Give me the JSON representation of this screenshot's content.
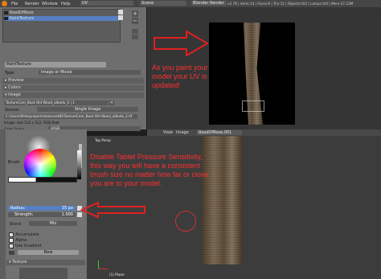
{
  "top_menu": {
    "items": [
      "File",
      "Render",
      "Window",
      "Help"
    ],
    "screen": "UV",
    "scene": "Scene",
    "engine": "Blender Render",
    "stats": "v2.78 | Verts:14 | Faces:6 | Tris:12 | Objects:0/2 | Lamps:0/0 | Mem:47.23M"
  },
  "uv_list": {
    "items": [
      "RoadOfRose",
      "PaintTexture"
    ]
  },
  "texture_panel": {
    "image_name": "PaintTexture",
    "image_type": "Image or Movie",
    "type_label": "Type",
    "preview_label": "Preview",
    "colors_label": "Colors",
    "image_label": "Image",
    "file_tab": "TextureCom_Boot Old Wood_albedo_S | 1",
    "source_label": "Source:",
    "source_value": "Single Image",
    "filepath": "C:\\Users\\Pete\\projects\\texturesHD\\TextureCom_Boot Old Wood_albedo_S.tif",
    "info": "Image: size 512 x 512, RGB float",
    "color_space_label": "Color Space",
    "color_space_value": "sRGB"
  },
  "uv_header": {
    "items": [
      "View",
      "Image"
    ],
    "image": "RoadOfRose.001"
  },
  "annotations": {
    "uv": "As you paint your model your UV is updated!",
    "pressure": "Disable Tablet Pressure Sensitivity, this way you will have a consistent brush size no matter how far or close you are to your model."
  },
  "brush_panel": {
    "brush_label": "Brush",
    "radius_label": "Radius:",
    "radius_value": "35 px",
    "strength_label": "Strength:",
    "strength_value": "1.000",
    "blend_label": "Blend",
    "blend_value": "Mix",
    "accumulate_label": "Accumulate",
    "alpha_label": "Alpha",
    "use_gradient_label": "Use Gradient",
    "new_label": "New",
    "texture_label": "Texture"
  },
  "viewport": {
    "view_name": "Top Persp",
    "object_label": "(1) Plane",
    "mode": "Texture Paint"
  },
  "colors": {
    "arrow": "#e02020",
    "annotation_text": "#ff3030"
  }
}
